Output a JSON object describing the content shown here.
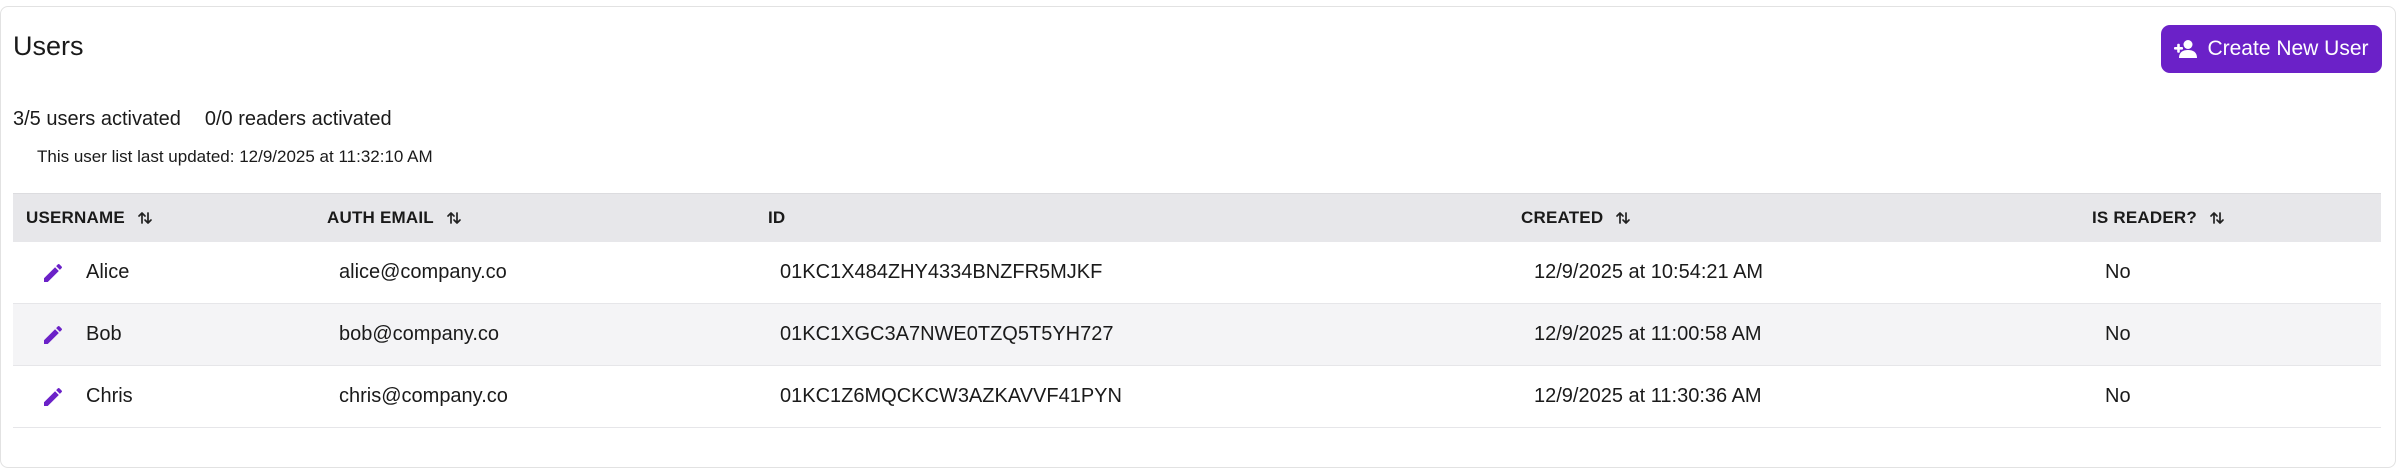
{
  "header": {
    "title": "Users",
    "create_button_label": "Create New User"
  },
  "stats": {
    "users_activated": "3/5 users activated",
    "readers_activated": "0/0 readers activated"
  },
  "last_updated": "This user list last updated: 12/9/2025 at 11:32:10 AM",
  "table": {
    "columns": [
      "USERNAME",
      "AUTH EMAIL",
      "ID",
      "CREATED",
      "IS READER?"
    ],
    "rows": [
      {
        "username": "Alice",
        "email": "alice@company.co",
        "id": "01KC1X484ZHY4334BNZFR5MJKF",
        "created": "12/9/2025 at 10:54:21 AM",
        "is_reader": "No"
      },
      {
        "username": "Bob",
        "email": "bob@company.co",
        "id": "01KC1XGC3A7NWE0TZQ5T5YH727",
        "created": "12/9/2025 at 11:00:58 AM",
        "is_reader": "No"
      },
      {
        "username": "Chris",
        "email": "chris@company.co",
        "id": "01KC1Z6MQCKCW3AZKAVVF41PYN",
        "created": "12/9/2025 at 11:30:36 AM",
        "is_reader": "No"
      }
    ]
  },
  "colors": {
    "accent": "#6b21c8",
    "header_bg": "#e7e7ea",
    "alt_row_bg": "#f4f4f6"
  },
  "icons": {
    "create_button": "user-plus-icon",
    "sort": "sort-icon",
    "row_edit": "pencil-icon"
  }
}
